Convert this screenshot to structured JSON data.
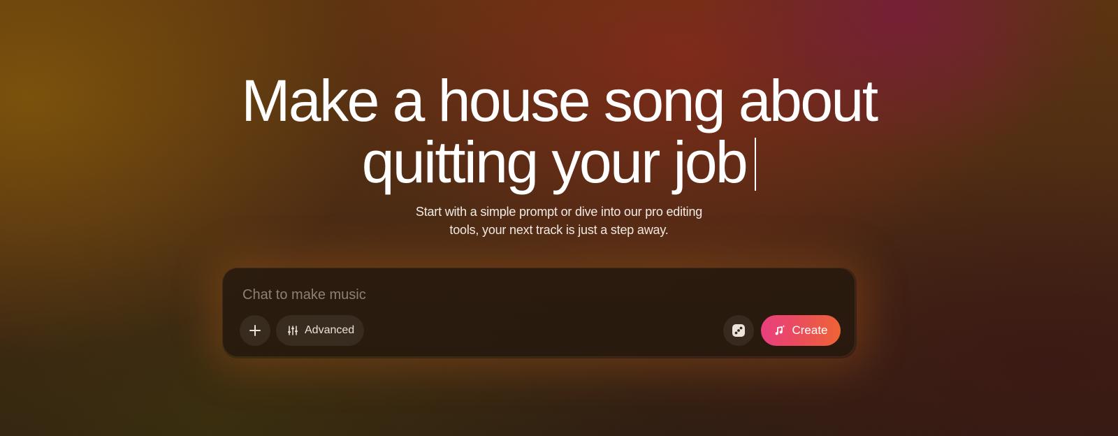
{
  "hero": {
    "headline_line1": "Make a house song about",
    "headline_line2": "quitting your job",
    "subtitle_line1": "Start with a simple prompt or dive into our pro editing",
    "subtitle_line2": "tools, your next track is just a step away."
  },
  "composer": {
    "placeholder": "Chat to make music",
    "value": "",
    "add_icon": "plus-icon",
    "advanced_label": "Advanced",
    "advanced_icon": "sliders-icon",
    "dice_icon": "dice-icon",
    "create_label": "Create",
    "create_icon": "music-note-sparkle-icon"
  },
  "colors": {
    "create_gradient_start": "#e8407e",
    "create_gradient_end": "#ee6434",
    "headline_text": "#ffffff"
  }
}
